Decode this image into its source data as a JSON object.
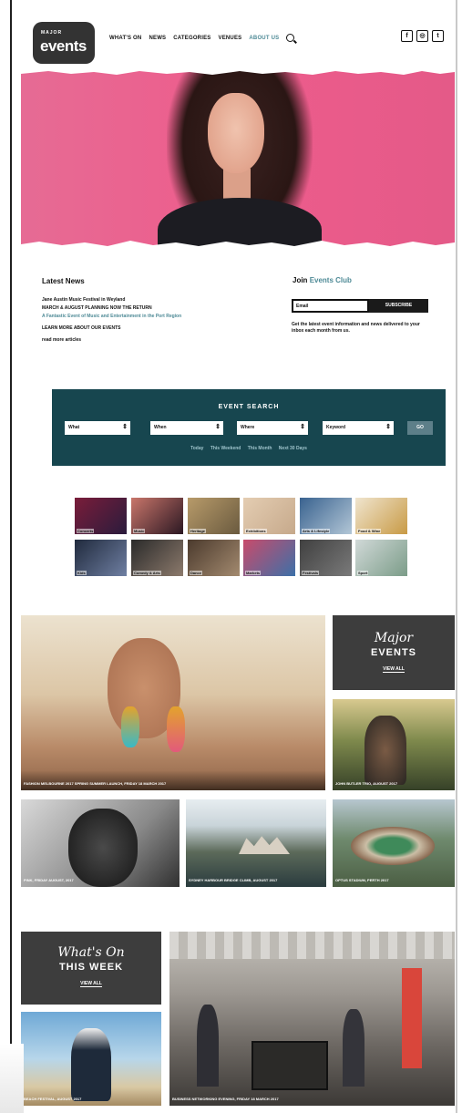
{
  "header": {
    "logo_small": "MAJOR",
    "logo_big": "events",
    "nav": [
      "WHAT'S ON",
      "NEWS",
      "CATEGORIES",
      "VENUES",
      "ABOUT US"
    ]
  },
  "news": {
    "title": "Latest News",
    "items": [
      "Jane Austin Music Festival in Weyland",
      "MARCH & AUGUST PLANNING NOW THE RETURN",
      "A Fantastic Event of Music and Entertainment in the Port Region",
      "LEARN MORE ABOUT OUR EVENTS",
      "read more articles"
    ]
  },
  "join": {
    "title": "Join",
    "accent": "Events Club",
    "email_placeholder": "Email",
    "subscribe_label": "SUBSCRIBE",
    "note": "Get the latest event information and news delivered to your inbox each month from us."
  },
  "event_search": {
    "title": "EVENT SEARCH",
    "selects": [
      "What",
      "When",
      "Where",
      "Keyword"
    ],
    "go_label": "GO",
    "quick_links": [
      "Today",
      "This Weekend",
      "This Month",
      "Next 30 Days"
    ]
  },
  "categories": [
    {
      "label": "Concerts",
      "color_a": "#7a1d3a",
      "color_b": "#2a1b3c"
    },
    {
      "label": "Music",
      "color_a": "#c9766b",
      "color_b": "#2b1722"
    },
    {
      "label": "Heritage",
      "color_a": "#b89b6a",
      "color_b": "#6a5a3f"
    },
    {
      "label": "Exhibitions",
      "color_a": "#e4cdb2",
      "color_b": "#c6a98b"
    },
    {
      "label": "Arts & Lifestyle",
      "color_a": "#39628f",
      "color_b": "#b2c6d6"
    },
    {
      "label": "Food & Wine",
      "color_a": "#f0e5cf",
      "color_b": "#c89a45"
    },
    {
      "label": "Kids",
      "color_a": "#202a3d",
      "color_b": "#6f7fa2"
    },
    {
      "label": "Comedy & Arts",
      "color_a": "#2a2a2a",
      "color_b": "#8c7a6c"
    },
    {
      "label": "Dance",
      "color_a": "#4b3a2d",
      "color_b": "#a38a6f"
    },
    {
      "label": "Markets",
      "color_a": "#c94b6b",
      "color_b": "#3c70a8"
    },
    {
      "label": "Festivals",
      "color_a": "#404040",
      "color_b": "#7a7a7a"
    },
    {
      "label": "Sport",
      "color_a": "#d1d9d8",
      "color_b": "#7b9c88"
    }
  ],
  "major_panel": {
    "script": "Major",
    "caps": "EVENTS",
    "view_all": "VIEW ALL"
  },
  "whats_on_panel": {
    "script": "What's On",
    "caps": "THIS WEEK",
    "view_all": "VIEW ALL"
  },
  "tiles": [
    {
      "caption": "FASHION MELBOURNE 2017 SPRING SUMMER LAUNCH, FRIDAY 18 MARCH 2017"
    },
    {
      "caption": "JOHN BUTLER TRIO, AUGUST 2017"
    },
    {
      "caption": "PINK, FRIDAY AUGUST, 2017"
    },
    {
      "caption": "SYDNEY HARBOUR BRIDGE CLIMB, AUGUST 2017"
    },
    {
      "caption": "OPTUS STADIUM, PERTH 2017"
    },
    {
      "caption": "BEACH FESTIVAL, AUGUST 2017"
    },
    {
      "caption": "BUSINESS NETWORKING EVENING, FRIDAY 18 MARCH 2017"
    }
  ]
}
